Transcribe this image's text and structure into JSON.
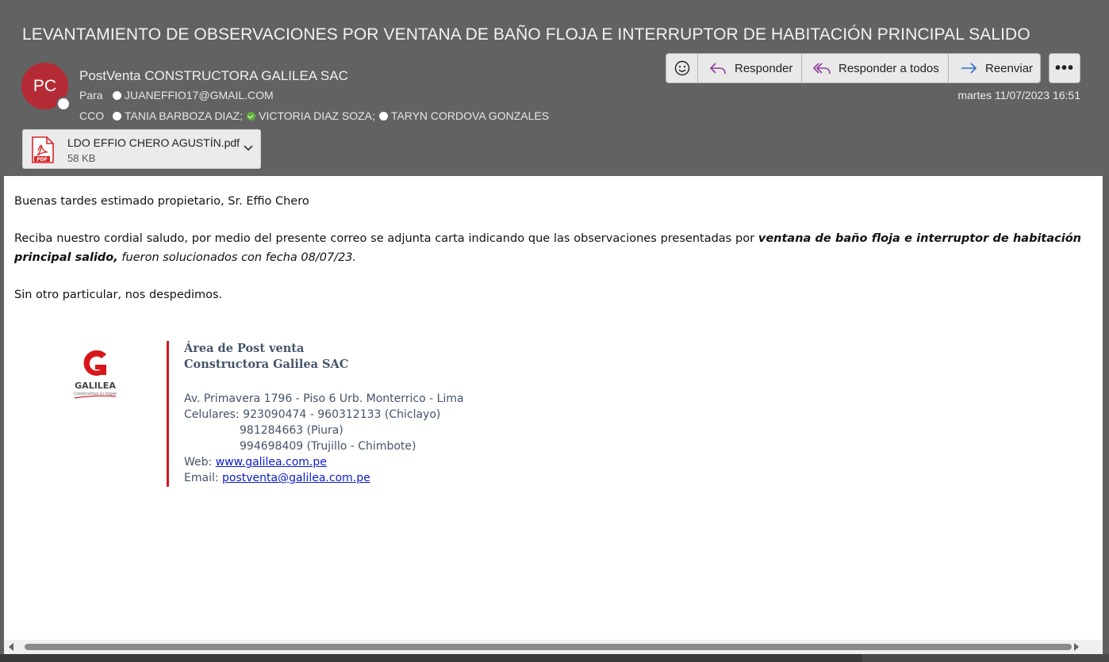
{
  "email": {
    "subject": "LEVANTAMIENTO DE OBSERVACIONES POR VENTANA DE BAÑO FLOJA E INTERRUPTOR DE HABITACIÓN PRINCIPAL SALIDO",
    "avatar_initials": "PC",
    "avatar_color": "#b52b35",
    "sender": "PostVenta CONSTRUCTORA GALILEA SAC",
    "to_label": "Para",
    "to": [
      "JUANEFFIO17@GMAIL.COM"
    ],
    "cco_label": "CCO",
    "cco": [
      "TANIA BARBOZA DIAZ;",
      "VICTORIA DIAZ SOZA;",
      "TARYN CORDOVA GONZALES"
    ],
    "datetime": "martes 11/07/2023 16:51"
  },
  "attachment": {
    "icon": "pdf-icon",
    "name": "LDO EFFIO CHERO AGUSTÍN.pdf",
    "size": "58 KB"
  },
  "toolbar": {
    "reply_label": "Responder",
    "reply_all_label": "Responder a todos",
    "forward_label": "Reenviar",
    "more_label": "•••"
  },
  "body": {
    "greeting": "Buenas tardes estimado propietario, Sr. Effio Chero",
    "p2_start": "Reciba nuestro cordial saludo, por medio del presente correo se adjunta carta indicando que las observaciones presentadas por ",
    "p2_bold": "ventana de baño floja e interruptor de habitación principal salido,",
    "p2_end": " fueron solucionados con fecha 08/07/23.",
    "closing": "Sin otro particular, nos despedimos."
  },
  "signature": {
    "logo_text": "GALILEA",
    "logo_tagline": "Construimos tu hogar",
    "line1": "Área de Post venta",
    "line2": "Constructora Galilea SAC",
    "address": "Av. Primavera 1796 - Piso 6 Urb. Monterrico - Lima",
    "phones_label": "Celulares: ",
    "phones1": "923090474 - 960312133 (Chiclayo)",
    "phones2": "981284663 (Piura)",
    "phones3": "994698409 (Trujillo - Chimbote)",
    "web_label": "Web: ",
    "web": "www.galilea.com.pe",
    "email_label": "Email: ",
    "email": "postventa@galilea.com.pe",
    "bar_color": "#d7161c"
  }
}
